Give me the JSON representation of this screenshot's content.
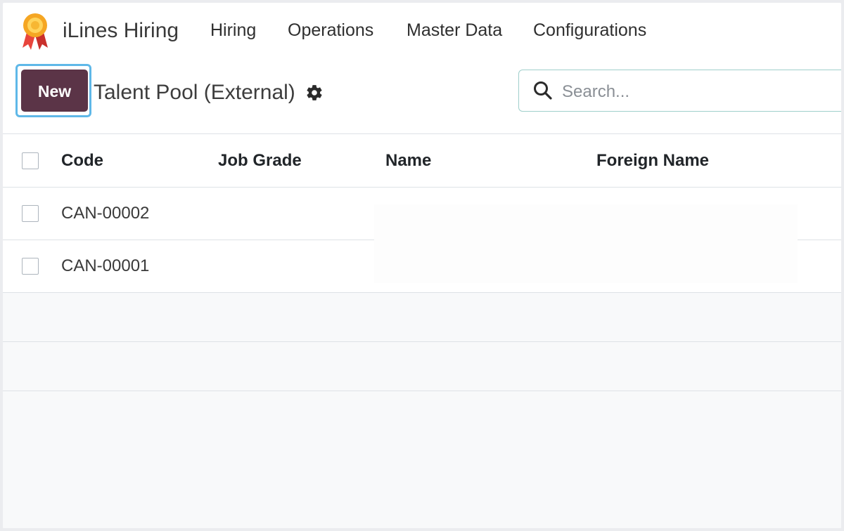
{
  "nav": {
    "app_name": "iLines Hiring",
    "menu": [
      "Hiring",
      "Operations",
      "Master Data",
      "Configurations"
    ]
  },
  "control_panel": {
    "new_label": "New",
    "title": "Talent Pool (External)",
    "search_placeholder": "Search..."
  },
  "table": {
    "columns": [
      "Code",
      "Job Grade",
      "Name",
      "Foreign Name"
    ],
    "rows": [
      {
        "code": "CAN-00002",
        "job_grade": "",
        "name": "",
        "foreign_name": ""
      },
      {
        "code": "CAN-00001",
        "job_grade": "",
        "name": "",
        "foreign_name": ""
      }
    ]
  },
  "colors": {
    "primary": "#5b3447",
    "focus_ring": "#5fb8e8",
    "search_border": "#9fcfcb"
  },
  "icons": {
    "logo": "award-ribbon-icon",
    "settings": "gear-icon",
    "search": "search-icon"
  }
}
